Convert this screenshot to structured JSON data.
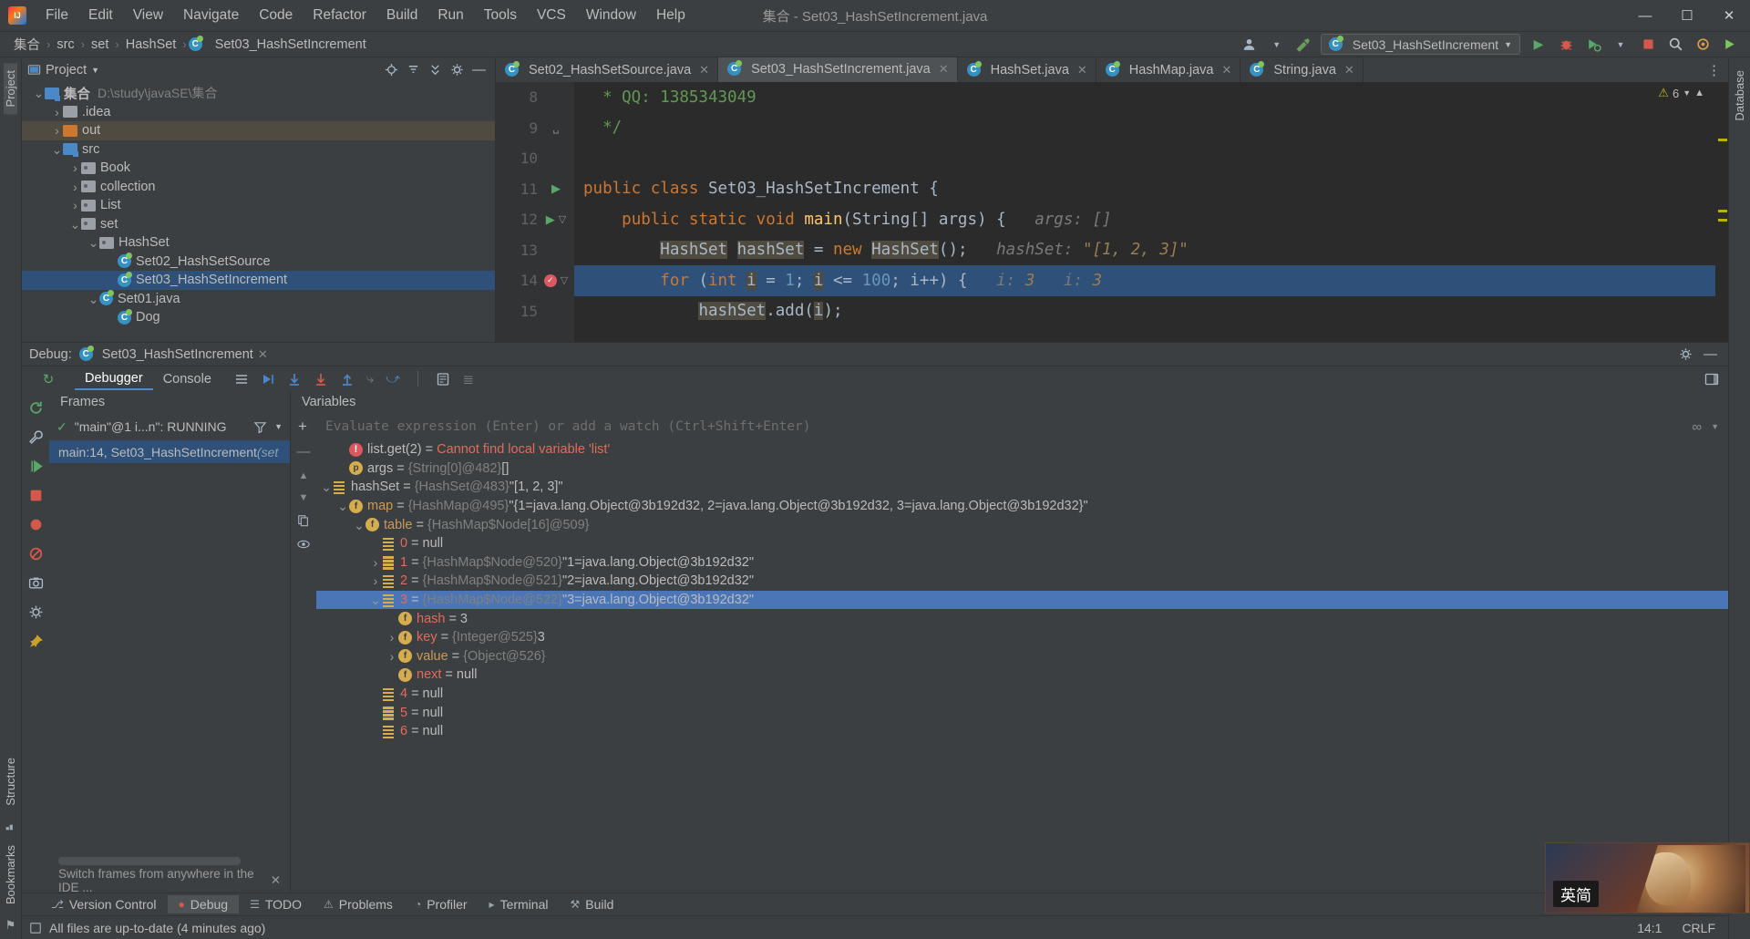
{
  "window": {
    "title": "集合 - Set03_HashSetIncrement.java",
    "logo": "intellij-idea-logo",
    "controls": {
      "minimize": "—",
      "maximize": "▢",
      "close": "✕"
    }
  },
  "menu": [
    "File",
    "Edit",
    "View",
    "Navigate",
    "Code",
    "Refactor",
    "Build",
    "Run",
    "Tools",
    "VCS",
    "Window",
    "Help"
  ],
  "breadcrumb": {
    "items": [
      "集合",
      "src",
      "set",
      "HashSet",
      "Set03_HashSetIncrement"
    ],
    "separator": "›"
  },
  "navbar_right": {
    "run_config": "Set03_HashSetIncrement",
    "icons": [
      "user-icon",
      "hammer-icon",
      "run-icon",
      "debug-icon",
      "run-with-coverage-icon",
      "stop-icon",
      "search-icon",
      "settings-icon",
      "updates-icon"
    ]
  },
  "project_panel": {
    "title": "Project",
    "header_icons": [
      "locate-icon",
      "collapse-all-icon",
      "expand-all-icon",
      "settings-icon",
      "hide-icon"
    ],
    "tree": [
      {
        "label": "集合",
        "path": "D:\\study\\javaSE\\集合",
        "indent": 0,
        "arrow": "v",
        "icon": "module-folder",
        "state": "normal"
      },
      {
        "label": ".idea",
        "path": "",
        "indent": 1,
        "arrow": ">",
        "icon": "folder-gray",
        "state": "normal"
      },
      {
        "label": "out",
        "path": "",
        "indent": 1,
        "arrow": ">",
        "icon": "folder-orange",
        "state": "highlight"
      },
      {
        "label": "src",
        "path": "",
        "indent": 1,
        "arrow": "v",
        "icon": "folder-blue",
        "state": "normal"
      },
      {
        "label": "Book",
        "path": "",
        "indent": 2,
        "arrow": ">",
        "icon": "package",
        "state": "normal"
      },
      {
        "label": "collection",
        "path": "",
        "indent": 2,
        "arrow": ">",
        "icon": "package",
        "state": "normal"
      },
      {
        "label": "List",
        "path": "",
        "indent": 2,
        "arrow": ">",
        "icon": "package",
        "state": "normal"
      },
      {
        "label": "set",
        "path": "",
        "indent": 2,
        "arrow": "v",
        "icon": "package",
        "state": "normal"
      },
      {
        "label": "HashSet",
        "path": "",
        "indent": 3,
        "arrow": "v",
        "icon": "package",
        "state": "normal"
      },
      {
        "label": "Set02_HashSetSource",
        "path": "",
        "indent": 4,
        "arrow": "",
        "icon": "java-class",
        "state": "normal"
      },
      {
        "label": "Set03_HashSetIncrement",
        "path": "",
        "indent": 4,
        "arrow": "",
        "icon": "java-class",
        "state": "selected"
      },
      {
        "label": "Set01.java",
        "path": "",
        "indent": 3,
        "arrow": "v",
        "icon": "java-class",
        "state": "normal"
      },
      {
        "label": "Dog",
        "path": "",
        "indent": 4,
        "arrow": "",
        "icon": "java-class",
        "state": "normal"
      }
    ]
  },
  "editor": {
    "tabs": [
      {
        "label": "Set02_HashSetSource.java",
        "active": false
      },
      {
        "label": "Set03_HashSetIncrement.java",
        "active": true
      },
      {
        "label": "HashSet.java",
        "active": false
      },
      {
        "label": "HashMap.java",
        "active": false
      },
      {
        "label": "String.java",
        "active": false
      }
    ],
    "inspection_count": "6",
    "lines": [
      {
        "num": "8",
        "gutter": "",
        "fold": "",
        "current": false,
        "tokens": [
          {
            "t": "  * QQ: 1385343049",
            "c": "cm"
          }
        ]
      },
      {
        "num": "9",
        "gutter": "",
        "fold": "fold-end",
        "current": false,
        "tokens": [
          {
            "t": "  */",
            "c": "cm"
          }
        ]
      },
      {
        "num": "10",
        "gutter": "",
        "fold": "",
        "current": false,
        "tokens": []
      },
      {
        "num": "11",
        "gutter": "run",
        "fold": "",
        "current": false,
        "tokens": [
          {
            "t": "public class ",
            "c": "kw"
          },
          {
            "t": "Set03_HashSetIncrement ",
            "c": "ty"
          },
          {
            "t": "{",
            "c": "plain"
          }
        ]
      },
      {
        "num": "12",
        "gutter": "run",
        "fold": "fold-open",
        "current": false,
        "tokens": [
          {
            "t": "    ",
            "c": "plain"
          },
          {
            "t": "public static void ",
            "c": "kw"
          },
          {
            "t": "main",
            "c": "fn"
          },
          {
            "t": "(String[] args) {",
            "c": "ty"
          },
          {
            "t": "   args: []",
            "c": "hint"
          }
        ]
      },
      {
        "num": "13",
        "gutter": "",
        "fold": "",
        "current": false,
        "tokens": [
          {
            "t": "        ",
            "c": "plain"
          },
          {
            "t": "HashSet",
            "c": "ty hlbox"
          },
          {
            "t": " ",
            "c": "plain"
          },
          {
            "t": "hashSet",
            "c": "ty hlbox"
          },
          {
            "t": " = ",
            "c": "plain"
          },
          {
            "t": "new",
            "c": "kw"
          },
          {
            "t": " ",
            "c": "plain"
          },
          {
            "t": "HashSet",
            "c": "ty hlbox"
          },
          {
            "t": "();",
            "c": "plain"
          },
          {
            "t": "   hashSet: ",
            "c": "hint"
          },
          {
            "t": "\"[1, 2, 3]\"",
            "c": "hint-val"
          }
        ]
      },
      {
        "num": "14",
        "gutter": "breakpoint",
        "fold": "fold-open",
        "current": true,
        "tokens": [
          {
            "t": "        ",
            "c": "plain"
          },
          {
            "t": "for",
            "c": "kw"
          },
          {
            "t": " (",
            "c": "plain"
          },
          {
            "t": "int",
            "c": "kw"
          },
          {
            "t": " ",
            "c": "plain"
          },
          {
            "t": "i",
            "c": "ty hlbox"
          },
          {
            "t": " = ",
            "c": "plain"
          },
          {
            "t": "1",
            "c": "num"
          },
          {
            "t": "; ",
            "c": "plain"
          },
          {
            "t": "i",
            "c": "ty hlbox"
          },
          {
            "t": " <= ",
            "c": "plain"
          },
          {
            "t": "100",
            "c": "num"
          },
          {
            "t": "; i++) {",
            "c": "plain"
          },
          {
            "t": "   i: ",
            "c": "hint"
          },
          {
            "t": "3",
            "c": "hint-val"
          },
          {
            "t": "   i: ",
            "c": "hint"
          },
          {
            "t": "3",
            "c": "hint-val"
          }
        ]
      },
      {
        "num": "15",
        "gutter": "",
        "fold": "",
        "current": false,
        "tokens": [
          {
            "t": "            ",
            "c": "plain"
          },
          {
            "t": "hashSet",
            "c": "ty hlbox"
          },
          {
            "t": ".",
            "c": "plain"
          },
          {
            "t": "add",
            "c": "plain"
          },
          {
            "t": "(",
            "c": "plain"
          },
          {
            "t": "i",
            "c": "ty hlbox"
          },
          {
            "t": ");",
            "c": "plain"
          }
        ]
      }
    ]
  },
  "debug": {
    "header_label": "Debug:",
    "session_tab": "Set03_HashSetIncrement",
    "tabs": [
      {
        "label": "Debugger",
        "active": true
      },
      {
        "label": "Console",
        "active": false
      }
    ],
    "frames": {
      "title": "Frames",
      "thread": "\"main\"@1 i...n\": RUNNING",
      "rows": [
        {
          "text": "main:14, Set03_HashSetIncrement ",
          "italic": "(set",
          "selected": true
        }
      ],
      "footer": "Switch frames from anywhere in the IDE ..."
    },
    "variables": {
      "title": "Variables",
      "evaluate_placeholder": "Evaluate expression (Enter) or add a watch (Ctrl+Shift+Enter)",
      "rows": [
        {
          "indent": 1,
          "arrow": "",
          "icon": "err",
          "name": "list.get(2)",
          "nameClass": "vname",
          "eq": "=",
          "type": "",
          "value": "Cannot find local variable 'list'",
          "valueClass": "verr",
          "selected": false
        },
        {
          "indent": 1,
          "arrow": "",
          "icon": "param",
          "name": "args",
          "nameClass": "vname",
          "eq": "=",
          "type": "{String[0]@482}",
          "value": "[]",
          "valueClass": "vval",
          "selected": false
        },
        {
          "indent": 0,
          "arrow": "v",
          "icon": "arr",
          "name": "hashSet",
          "nameClass": "vname",
          "eq": "=",
          "type": "{HashSet@483}",
          "value": "\"[1, 2, 3]\"",
          "valueClass": "vval",
          "selected": false
        },
        {
          "indent": 1,
          "arrow": "v",
          "icon": "field",
          "name": "map",
          "nameClass": "vname orange",
          "eq": "=",
          "type": "{HashMap@495}",
          "value": "\"{1=java.lang.Object@3b192d32, 2=java.lang.Object@3b192d32, 3=java.lang.Object@3b192d32}\"",
          "valueClass": "vval",
          "selected": false
        },
        {
          "indent": 2,
          "arrow": "v",
          "icon": "field",
          "name": "table",
          "nameClass": "vname orange",
          "eq": "=",
          "type": "{HashMap$Node[16]@509}",
          "value": "",
          "valueClass": "vval",
          "selected": false
        },
        {
          "indent": 3,
          "arrow": "",
          "icon": "arr",
          "name": "0",
          "nameClass": "vname red",
          "eq": "=",
          "type": "",
          "value": "null",
          "valueClass": "vval",
          "selected": false
        },
        {
          "indent": 3,
          "arrow": ">",
          "icon": "arr",
          "name": "1",
          "nameClass": "vname red",
          "eq": "=",
          "type": "{HashMap$Node@520}",
          "value": "\"1=java.lang.Object@3b192d32\"",
          "valueClass": "vval",
          "selected": false
        },
        {
          "indent": 3,
          "arrow": ">",
          "icon": "arr",
          "name": "2",
          "nameClass": "vname red",
          "eq": "=",
          "type": "{HashMap$Node@521}",
          "value": "\"2=java.lang.Object@3b192d32\"",
          "valueClass": "vval",
          "selected": false
        },
        {
          "indent": 3,
          "arrow": "v",
          "icon": "arr",
          "name": "3",
          "nameClass": "vname red",
          "eq": "=",
          "type": "{HashMap$Node@522}",
          "value": "\"3=java.lang.Object@3b192d32\"",
          "valueClass": "vval",
          "selected": true
        },
        {
          "indent": 4,
          "arrow": "",
          "icon": "field",
          "name": "hash",
          "nameClass": "vname red",
          "eq": "=",
          "type": "",
          "value": "3",
          "valueClass": "vval",
          "selected": false
        },
        {
          "indent": 4,
          "arrow": ">",
          "icon": "field",
          "name": "key",
          "nameClass": "vname red",
          "eq": "=",
          "type": "{Integer@525}",
          "value": "3",
          "valueClass": "vval",
          "selected": false
        },
        {
          "indent": 4,
          "arrow": ">",
          "icon": "field",
          "name": "value",
          "nameClass": "vname orange",
          "eq": "=",
          "type": "{Object@526}",
          "value": "",
          "valueClass": "vval",
          "selected": false
        },
        {
          "indent": 4,
          "arrow": "",
          "icon": "field",
          "name": "next",
          "nameClass": "vname red",
          "eq": "=",
          "type": "",
          "value": "null",
          "valueClass": "vval",
          "selected": false
        },
        {
          "indent": 3,
          "arrow": "",
          "icon": "arr",
          "name": "4",
          "nameClass": "vname red",
          "eq": "=",
          "type": "",
          "value": "null",
          "valueClass": "vval",
          "selected": false
        },
        {
          "indent": 3,
          "arrow": "",
          "icon": "arr",
          "name": "5",
          "nameClass": "vname red",
          "eq": "=",
          "type": "",
          "value": "null",
          "valueClass": "vval",
          "selected": false
        },
        {
          "indent": 3,
          "arrow": "",
          "icon": "arr",
          "name": "6",
          "nameClass": "vname red",
          "eq": "=",
          "type": "",
          "value": "null",
          "valueClass": "vval",
          "selected": false
        }
      ]
    }
  },
  "bottom_tabs": [
    {
      "label": "Version Control",
      "icon": "branch-icon",
      "active": false
    },
    {
      "label": "Debug",
      "icon": "bug-icon",
      "active": true
    },
    {
      "label": "TODO",
      "icon": "list-icon",
      "active": false
    },
    {
      "label": "Problems",
      "icon": "warning-icon",
      "active": false
    },
    {
      "label": "Profiler",
      "icon": "gauge-icon",
      "active": false
    },
    {
      "label": "Terminal",
      "icon": "terminal-icon",
      "active": false
    },
    {
      "label": "Build",
      "icon": "hammer-icon",
      "active": false
    }
  ],
  "statusbar": {
    "message": "All files are up-to-date (4 minutes ago)",
    "caret": "14:1",
    "line_sep": "CRLF"
  },
  "left_rail": {
    "items": [
      "Project",
      "Structure",
      "Bookmarks"
    ]
  },
  "right_rail": {
    "items": [
      "Database"
    ]
  },
  "overlay": {
    "ime_label": "英简"
  },
  "colors": {
    "accent_blue": "#4a88c7",
    "selection": "#2f5179",
    "var_selection": "#4a76b8",
    "bg": "#3c3f41",
    "editor_bg": "#2b2b2b",
    "keyword": "#cc7832",
    "string": "#6a8759",
    "comment": "#629755",
    "number": "#6897bb",
    "error": "#e06c5a"
  }
}
